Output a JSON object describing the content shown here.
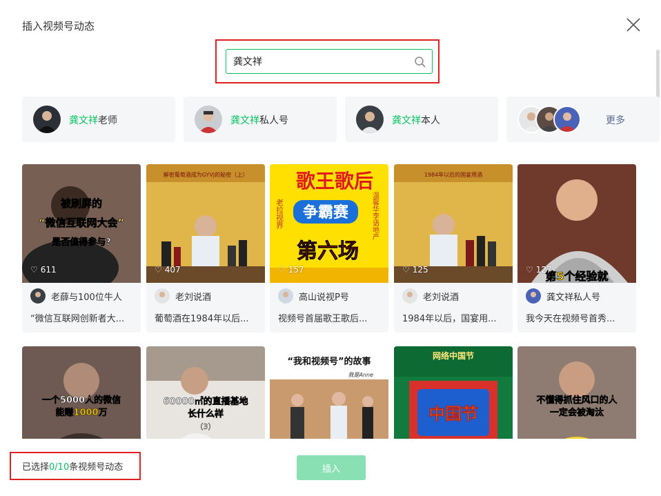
{
  "dialog": {
    "title": "插入视频号动态"
  },
  "search": {
    "value": "龚文祥",
    "icon": "search-icon"
  },
  "accounts": [
    {
      "highlight": "龚文祥",
      "suffix": "老师"
    },
    {
      "highlight": "龚文祥",
      "suffix": "私人号"
    },
    {
      "highlight": "龚文祥",
      "suffix": "本人"
    }
  ],
  "more": {
    "label": "更多"
  },
  "cards": [
    {
      "likes": "611",
      "author": "老薛与100位牛人",
      "desc": "“微信互联网创新者大...",
      "overlay": [
        "被刷屏的",
        "“微信互联网大会”",
        "是否值得参与?"
      ]
    },
    {
      "likes": "407",
      "author": "老刘说酒",
      "desc": "葡萄酒在1984年以后...",
      "overlay": [
        "解密葡萄酒成为GYVJ的秘密（上）"
      ]
    },
    {
      "likes": "157",
      "author": "高山说视P号",
      "desc": "视频号首届歌王歌后...",
      "overlay": [
        "歌王歌后",
        "争霸赛",
        "第六场",
        "老拉视界",
        "温馨华李语地产"
      ]
    },
    {
      "likes": "125",
      "author": "老刘说酒",
      "desc": "1984年以后，国宴用...",
      "overlay": [
        "1984年以后的国宴用酒"
      ]
    },
    {
      "likes": "127",
      "author": "龚文祥私人号",
      "desc": "我今天在视频号首秀...",
      "overlay": [
        "第5个经验就"
      ]
    },
    {
      "overlay": [
        "一个5000人的微信",
        "能赚1000万"
      ]
    },
    {
      "overlay": [
        "60000㎡的直播基地",
        "长什么样",
        "（3）"
      ]
    },
    {
      "overlay": [
        "“我和视频号”的故事",
        "我是Anne"
      ]
    },
    {
      "overlay": [
        "网络中国节",
        "中国节"
      ]
    },
    {
      "overlay": [
        "不懂得抓住风口的人",
        "一定会被淘汰"
      ]
    }
  ],
  "footer": {
    "prefix": "已选择",
    "count": "0/10",
    "suffix": "条视频号动态"
  },
  "insert_button": {
    "label": "插入"
  },
  "colors": {
    "accent": "#07c160",
    "highlight_box": "#e02020",
    "button_disabled": "#88e0b3"
  }
}
